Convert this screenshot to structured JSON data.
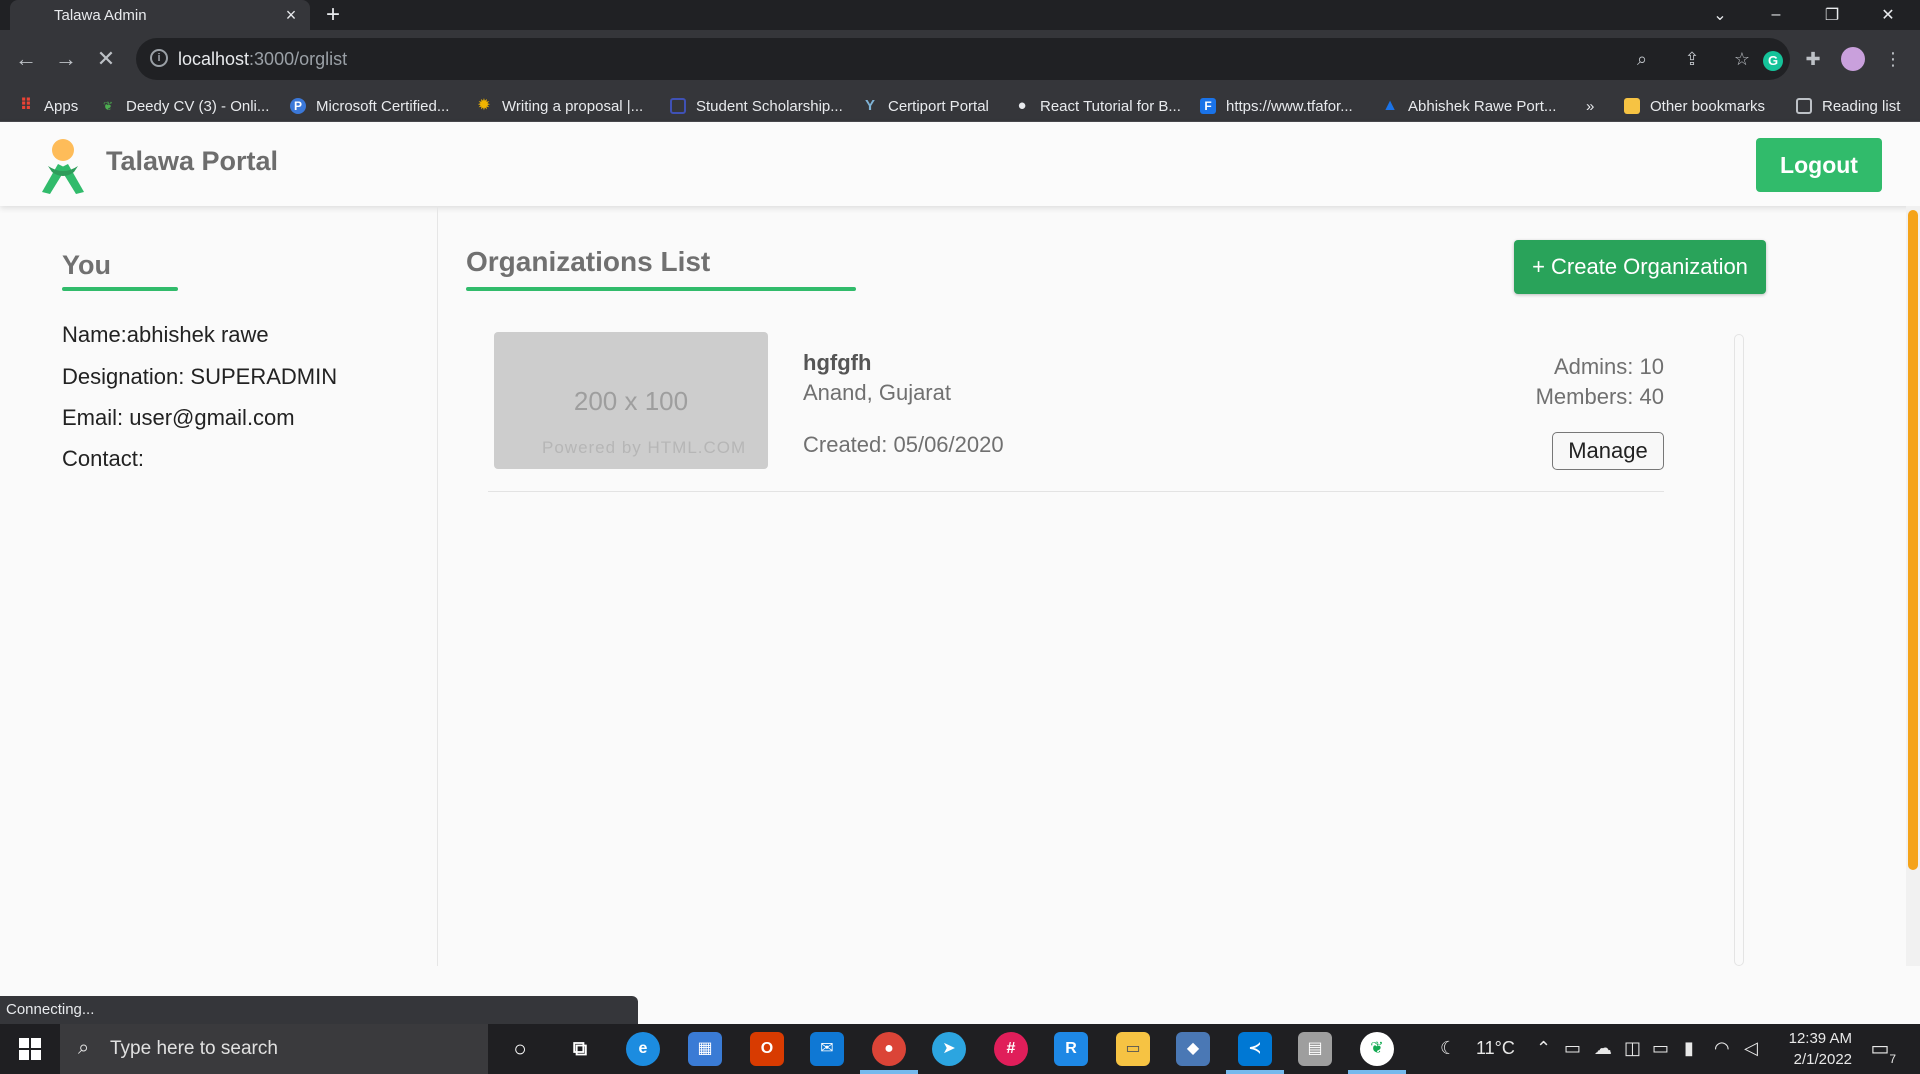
{
  "browser": {
    "tab_title": "Talawa Admin",
    "tab_close": "×",
    "new_tab": "+",
    "url_host": "localhost",
    "url_rest": ":3000/orglist",
    "bookmarks": [
      {
        "label": "Apps",
        "icon": "apps-grid-icon",
        "color": "#ea4335"
      },
      {
        "label": "Deedy CV (3) - Onli...",
        "icon": "overleaf-icon",
        "color": "#4caf50"
      },
      {
        "label": "Microsoft Certified...",
        "icon": "p-icon",
        "color": "#3b78d8"
      },
      {
        "label": "Writing a proposal |...",
        "icon": "sun-icon",
        "color": "#f0b400"
      },
      {
        "label": "Student Scholarship...",
        "icon": "book-icon",
        "color": "#3f51b5"
      },
      {
        "label": "Certiport Portal",
        "icon": "certiport-icon",
        "color": "#7fb3d5"
      },
      {
        "label": "React Tutorial for B...",
        "icon": "person-icon",
        "color": "#9aa0a6"
      },
      {
        "label": "https://www.tfafor...",
        "icon": "f-icon",
        "color": "#1a73e8"
      },
      {
        "label": "Abhishek Rawe Port...",
        "icon": "a-icon",
        "color": "#1a73e8"
      }
    ],
    "more_bookmarks": "»",
    "other_bookmarks": "Other bookmarks",
    "reading_list": "Reading list"
  },
  "header": {
    "brand": "Talawa Portal",
    "logout_label": "Logout"
  },
  "profile": {
    "title": "You",
    "name_line": "Name:abhishek rawe",
    "designation_line": "Designation: SUPERADMIN",
    "email_line": "Email: user@gmail.com",
    "contact_line": "Contact:"
  },
  "main": {
    "title": "Organizations List",
    "create_label": "+ Create Organization",
    "organizations": [
      {
        "image_size_text": "200 x 100",
        "image_powered_text": "Powered by HTML.COM",
        "name": "hgfgfh",
        "location": "Anand, Gujarat",
        "created": "Created: 05/06/2020",
        "admins": "Admins: 10",
        "members": "Members: 40",
        "manage_label": "Manage"
      }
    ]
  },
  "status_text": "Connecting...",
  "taskbar": {
    "search_placeholder": "Type here to search",
    "weather": "11°C",
    "time": "12:39 AM",
    "date": "2/1/2022",
    "notification_count": "7"
  },
  "colors": {
    "accent_green": "#31bb6b",
    "button_green": "#29a35a",
    "scroll_orange": "#f5a31a"
  }
}
